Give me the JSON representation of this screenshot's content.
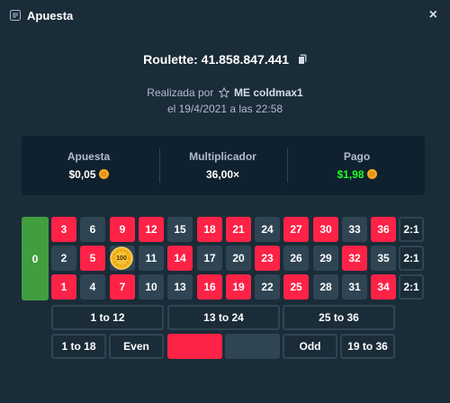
{
  "header": {
    "title": "Apuesta",
    "close": "×"
  },
  "game": {
    "label": "Roulette: 41.858.847.441"
  },
  "made_by": {
    "prefix": "Realizada por",
    "user": "ME coldmax1",
    "date": "el 19/4/2021 a las 22:58"
  },
  "stats": [
    {
      "label": "Apuesta",
      "value": "$0,05",
      "currency_icon": "coin-icon"
    },
    {
      "label": "Multiplicador",
      "value": "36,00×"
    },
    {
      "label": "Pago",
      "value": "$1,98",
      "currency_icon": "coin-icon",
      "color": "#1fff20"
    }
  ],
  "board": {
    "zero": "0",
    "rows": [
      [
        {
          "n": "3",
          "c": "red"
        },
        {
          "n": "6",
          "c": "black"
        },
        {
          "n": "9",
          "c": "red"
        },
        {
          "n": "12",
          "c": "red"
        },
        {
          "n": "15",
          "c": "black"
        },
        {
          "n": "18",
          "c": "red"
        },
        {
          "n": "21",
          "c": "red"
        },
        {
          "n": "24",
          "c": "black"
        },
        {
          "n": "27",
          "c": "red"
        },
        {
          "n": "30",
          "c": "red"
        },
        {
          "n": "33",
          "c": "black"
        },
        {
          "n": "36",
          "c": "red"
        }
      ],
      [
        {
          "n": "2",
          "c": "black"
        },
        {
          "n": "5",
          "c": "red"
        },
        {
          "n": "8",
          "c": "black"
        },
        {
          "n": "11",
          "c": "black"
        },
        {
          "n": "14",
          "c": "red"
        },
        {
          "n": "17",
          "c": "black"
        },
        {
          "n": "20",
          "c": "black"
        },
        {
          "n": "23",
          "c": "red"
        },
        {
          "n": "26",
          "c": "black"
        },
        {
          "n": "29",
          "c": "black"
        },
        {
          "n": "32",
          "c": "red"
        },
        {
          "n": "35",
          "c": "black"
        }
      ],
      [
        {
          "n": "1",
          "c": "red"
        },
        {
          "n": "4",
          "c": "black"
        },
        {
          "n": "7",
          "c": "red"
        },
        {
          "n": "10",
          "c": "black"
        },
        {
          "n": "13",
          "c": "black"
        },
        {
          "n": "16",
          "c": "red"
        },
        {
          "n": "19",
          "c": "red"
        },
        {
          "n": "22",
          "c": "black"
        },
        {
          "n": "25",
          "c": "red"
        },
        {
          "n": "28",
          "c": "black"
        },
        {
          "n": "31",
          "c": "black"
        },
        {
          "n": "34",
          "c": "red"
        }
      ]
    ],
    "column_bets": [
      "2:1",
      "2:1",
      "2:1"
    ],
    "dozens": [
      "1 to 12",
      "13 to 24",
      "25 to 36"
    ],
    "even_money": [
      "1 to 18",
      "Even",
      "",
      "",
      "Odd",
      "19 to 36"
    ],
    "chip": {
      "value": "100",
      "on_number": "8"
    }
  },
  "colors": {
    "red": "#fe2247",
    "black": "#2f4553",
    "green": "#419e3f",
    "background": "#1a2c38",
    "panel": "#0f212e",
    "payout": "#1fff20"
  }
}
